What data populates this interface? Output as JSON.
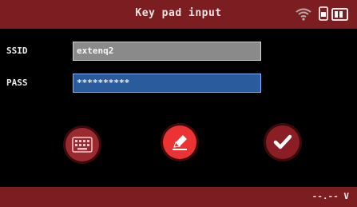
{
  "header": {
    "title": "Key pad input",
    "icons": [
      "wifi-icon",
      "sim-card-icon",
      "battery-icon"
    ]
  },
  "form": {
    "ssid_label": "SSID",
    "ssid_value": "extenq2",
    "pass_label": "PASS",
    "pass_value": "**********"
  },
  "actions": {
    "keyboard_icon": "keyboard-icon",
    "edit_icon": "pencil-icon",
    "confirm_icon": "check-icon"
  },
  "footer": {
    "voltage": "--.-- V"
  },
  "colors": {
    "header_bg": "#7c1e21",
    "pass_field_bg": "#2a5c9d",
    "ssid_field_bg": "#8a8a8a",
    "edit_button": "#ea3332"
  }
}
